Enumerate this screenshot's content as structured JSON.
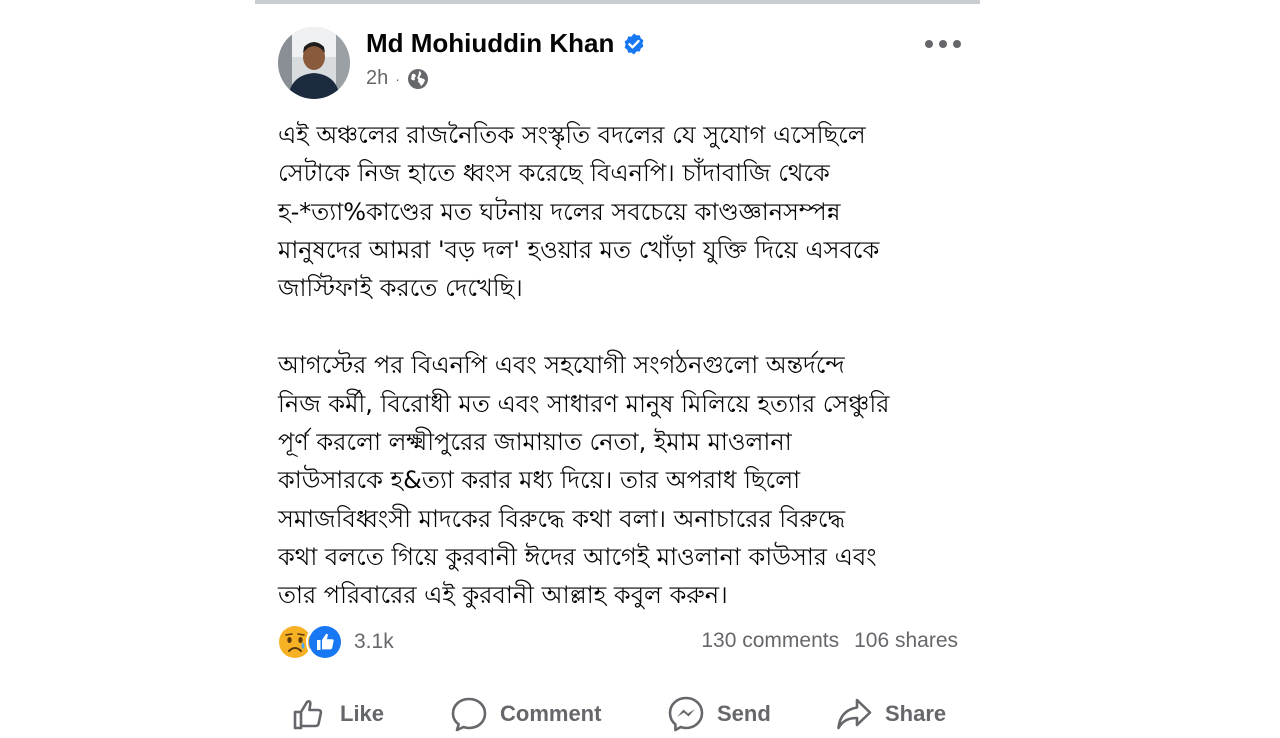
{
  "post": {
    "author": {
      "name": "Md Mohiuddin Khan",
      "verified_icon": "verified-badge-icon",
      "verified_color": "#1877f2"
    },
    "time": "2h",
    "audience_icon": "globe-icon",
    "paragraphs": [
      "এই অঞ্চলের রাজনৈতিক সংস্কৃতি বদলের যে সুযোগ এসেছিলে\nসেটাকে নিজ হাতে ধ্বংস করেছে বিএনপি। চাঁদাবাজি থেকে\nহ-*ত্যা%কাণ্ডের মত ঘটনায় দলের সবচেয়ে কাণ্ডজ্ঞানসম্পন্ন\nমানুষদের আমরা 'বড় দল' হওয়ার মত খোঁড়া যুক্তি দিয়ে এসবকে\nজাস্টিফাই করতে দেখেছি।",
      "আগস্টের পর বিএনপি এবং সহযোগী সংগঠনগুলো অন্তর্দন্দে\nনিজ কর্মী, বিরোধী মত এবং সাধারণ মানুষ মিলিয়ে হত্যার সেঞ্চুরি\nপূর্ণ করলো লক্ষ্মীপুরের জামায়াত নেতা, ইমাম মাওলানা\nকাউসারকে হ&ত্যা করার মধ্য দিয়ে। তার অপরাধ ছিলো\nসমাজবিধ্বংসী মাদকের বিরুদ্ধে কথা বলা। অনাচারের বিরুদ্ধে\nকথা বলতে গিয়ে কুরবানী ঈদের আগেই মাওলানা কাউসার এবং\nতার পরিবারের এই কুরবানী আল্লাহ কবুল করুন।"
    ],
    "reactions": {
      "icons": [
        "sad-reaction-icon",
        "like-reaction-icon"
      ],
      "count": "3.1k"
    },
    "comments": "130 comments",
    "shares": "106 shares",
    "actions": {
      "like": "Like",
      "comment": "Comment",
      "send": "Send",
      "share": "Share"
    },
    "colors": {
      "text": "#050505",
      "secondary": "#65676b",
      "like_blue": "#1877f2",
      "sad_yellow": "#f7b125"
    }
  }
}
